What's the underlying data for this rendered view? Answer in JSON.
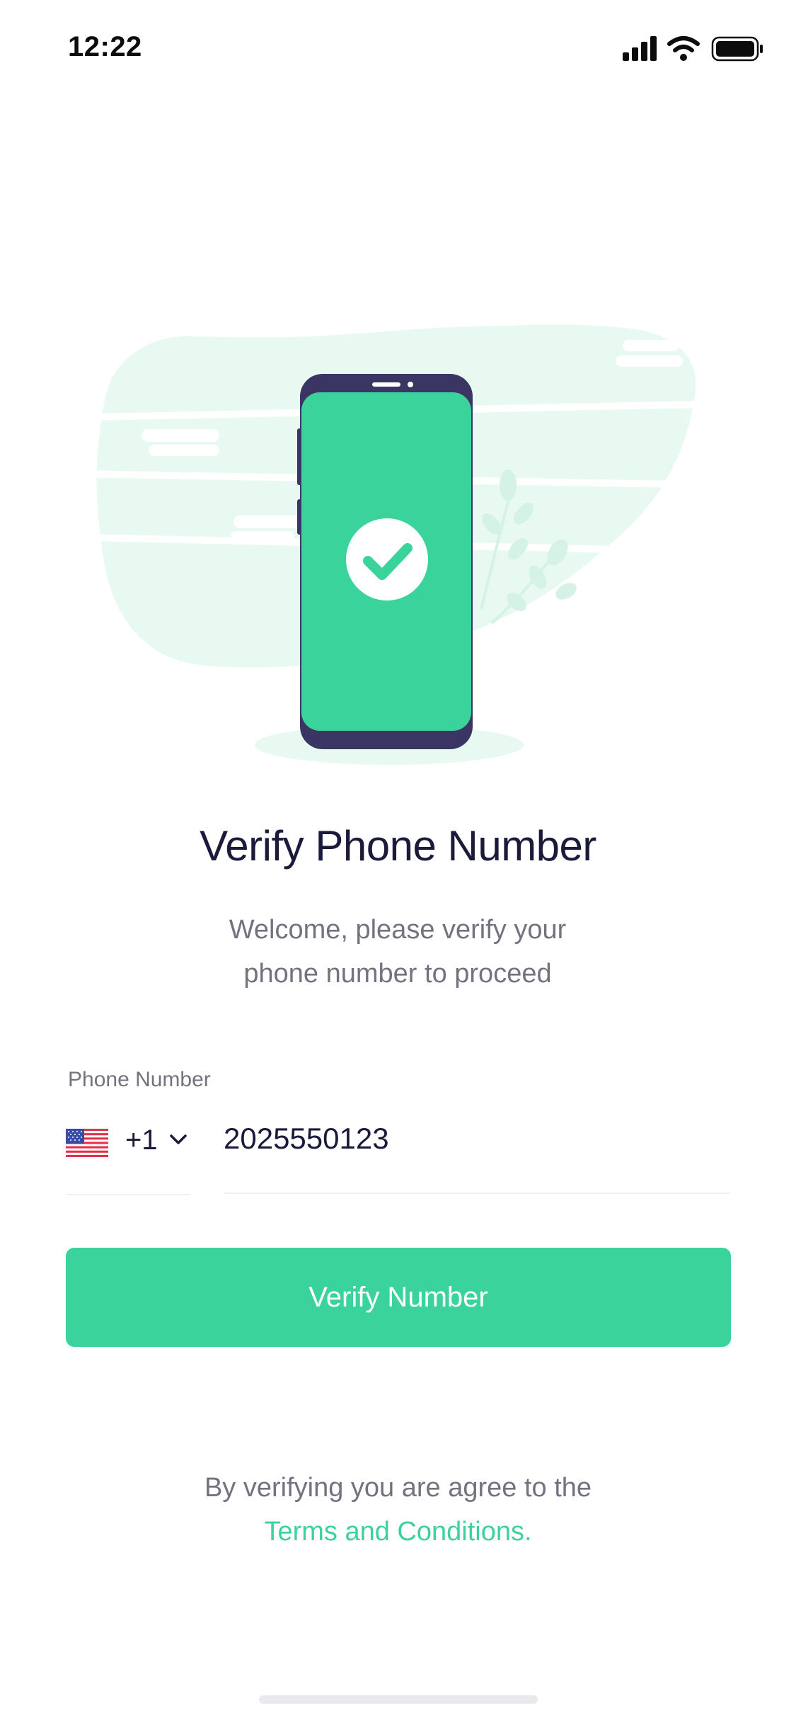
{
  "status_bar": {
    "time": "12:22",
    "icons": [
      "signal-icon",
      "wifi-icon",
      "battery-icon"
    ]
  },
  "illustration": {
    "name": "phone-verified-illustration",
    "colors": {
      "accent": "#3bd39c",
      "phone_body": "#3b3563",
      "background_blob": "#e8f9f2"
    }
  },
  "header": {
    "title": "Verify Phone Number",
    "subtitle_line1": "Welcome, please verify your",
    "subtitle_line2": "phone number to proceed"
  },
  "form": {
    "phone_label": "Phone Number",
    "country": {
      "flag": "us-flag-icon",
      "dial_code": "+1"
    },
    "phone_value": "2025550123"
  },
  "actions": {
    "verify_label": "Verify Number"
  },
  "footer": {
    "agreement_text": "By verifying you are agree to the",
    "terms_link": "Terms and Conditions."
  },
  "theme": {
    "accent": "#3bd39c",
    "text_primary": "#1a1b3a",
    "text_secondary": "#72737f"
  }
}
